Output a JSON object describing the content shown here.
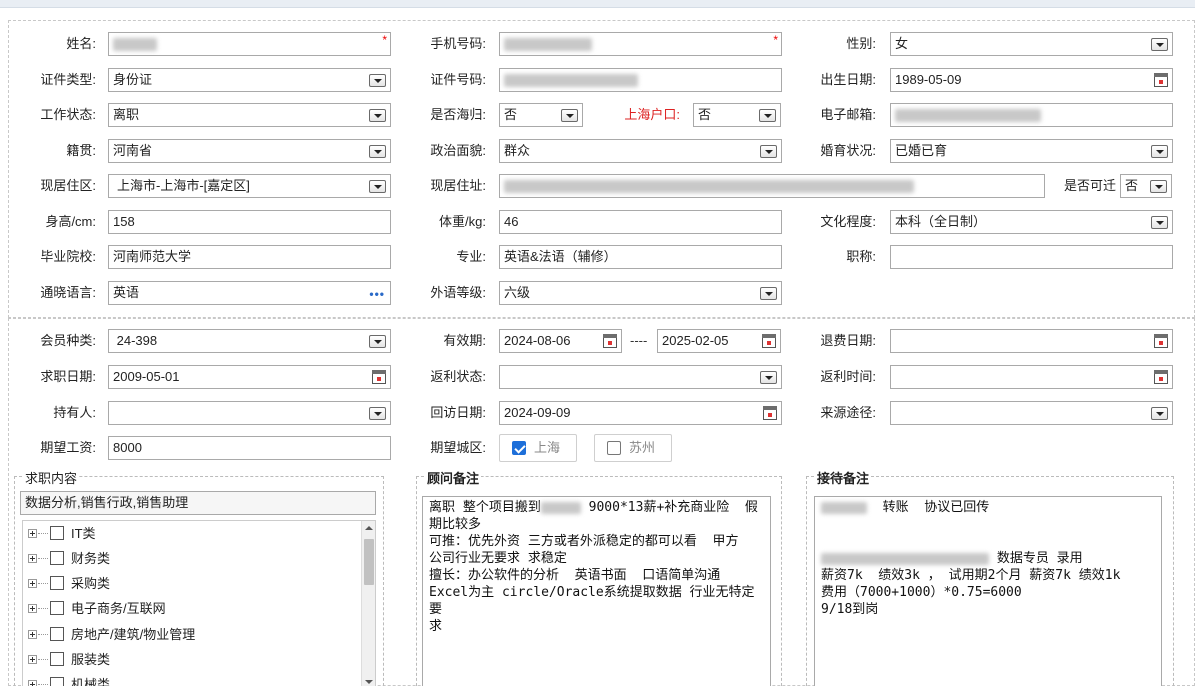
{
  "basic": {
    "name_label": "姓名:",
    "phone_label": "手机号码:",
    "gender_label": "性别:",
    "gender_value": "女",
    "idtype_label": "证件类型:",
    "idtype_value": "身份证",
    "idno_label": "证件号码:",
    "birth_label": "出生日期:",
    "birth_value": "1989-05-09",
    "workstatus_label": "工作状态:",
    "workstatus_value": "离职",
    "returnee_label": "是否海归:",
    "returnee_value": "否",
    "shhukou_label": "上海户口:",
    "shhukou_value": "否",
    "email_label": "电子邮箱:",
    "native_label": "籍贯:",
    "native_value": "河南省",
    "political_label": "政治面貌:",
    "political_value": "群众",
    "marital_label": "婚育状况:",
    "marital_value": "已婚已育",
    "residence_area_label": "现居住区:",
    "residence_area_value": "上海市-上海市-[嘉定区]",
    "address_label": "现居住址:",
    "relocate_label": "是否可迁",
    "relocate_value": "否",
    "height_label": "身高/cm:",
    "height_value": "158",
    "weight_label": "体重/kg:",
    "weight_value": "46",
    "education_label": "文化程度:",
    "education_value": "本科（全日制）",
    "school_label": "毕业院校:",
    "school_value": "河南师范大学",
    "major_label": "专业:",
    "major_value": "英语&法语（辅修）",
    "title_label": "职称:",
    "language_label": "通晓语言:",
    "language_value": "英语",
    "lang_level_label": "外语等级:",
    "lang_level_value": "六级"
  },
  "member": {
    "type_label": "会员种类:",
    "type_value": " 24-398",
    "valid_label": "有效期:",
    "valid_from": "2024-08-06",
    "valid_sep": "----",
    "valid_to": "2025-02-05",
    "refund_date_label": "退费日期:",
    "job_date_label": "求职日期:",
    "job_date_value": "2009-05-01",
    "rebate_status_label": "返利状态:",
    "rebate_time_label": "返利时间:",
    "holder_label": "持有人:",
    "visit_date_label": "回访日期:",
    "visit_date_value": "2024-09-09",
    "source_label": "来源途径:",
    "salary_label": "期望工资:",
    "salary_value": "8000",
    "city_label": "期望城区:",
    "cities": [
      {
        "label": "上海",
        "checked": true
      },
      {
        "label": "苏州",
        "checked": false
      }
    ]
  },
  "job": {
    "legend": "求职内容",
    "selected": "数据分析,销售行政,销售助理",
    "categories": [
      "IT类",
      "财务类",
      "采购类",
      "电子商务/互联网",
      "房地产/建筑/物业管理",
      "服装类",
      "机械类"
    ]
  },
  "consultant": {
    "legend": "顾问备注",
    "line1_a": "离职 整个项目搬到",
    "line1_b": " 9000*13薪+补充商业险  假",
    "line2": "期比较多",
    "line3": "可推：优先外资 三方或者外派稳定的都可以看  甲方",
    "line4": "公司行业无要求 求稳定",
    "line5": "擅长：办公软件的分析  英语书面  口语简单沟通",
    "line6": "Excel为主 circle/Oracle系统提取数据 行业无特定要",
    "line7": "求"
  },
  "reception": {
    "legend": "接待备注",
    "line1": "  转账  协议已回传",
    "line2": " 数据专员 录用",
    "line3": "薪资7k  绩效3k ， 试用期2个月 薪资7k 绩效1k",
    "line4": "费用（7000+1000）*0.75=6000",
    "line5": "9/18到岗"
  }
}
